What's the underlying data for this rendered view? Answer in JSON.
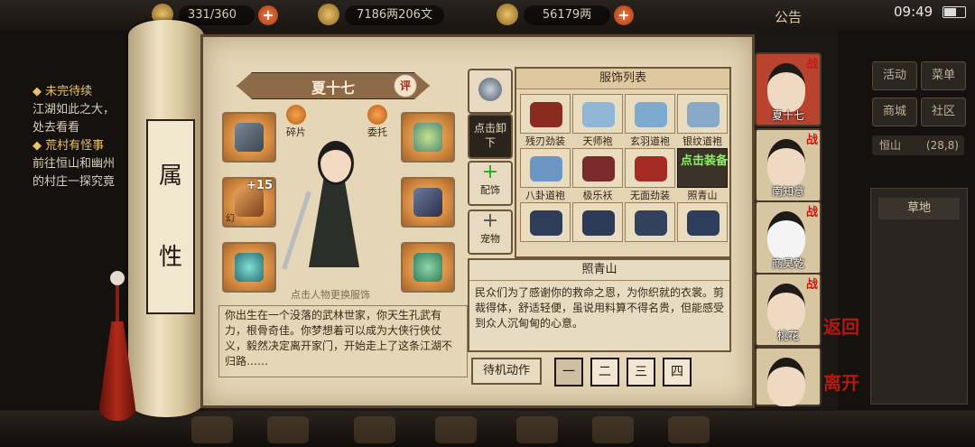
{
  "topbar": {
    "food": "331/360",
    "money": "7186两206文",
    "silver": "56179两",
    "notice": "公告",
    "time": "09:49"
  },
  "quests": [
    {
      "title": "未完待续",
      "text": "江湖如此之大，处去看看"
    },
    {
      "title": "荒村有怪事",
      "text": "前往恒山和幽州的村庄一探究竟"
    }
  ],
  "scroll": {
    "label_top": "属",
    "label_bottom": "性"
  },
  "character": {
    "name": "夏十七",
    "rate_label": "评",
    "fragment_label": "碎片",
    "entrust_label": "委托",
    "tap_hint": "点击人物更换服饰",
    "bio": "你出生在一个没落的武林世家，你天生孔武有力，根骨奇佳。你梦想着可以成为大侠行侠仗义，毅然决定离开家门，开始走上了这条江湖不归路……"
  },
  "slots": {
    "level": "+15",
    "tag": "幻"
  },
  "side_buttons": {
    "unequip": "点击卸下",
    "accessory": "配饰",
    "pet": "宠物"
  },
  "outfit": {
    "title": "服饰列表",
    "items": [
      {
        "label": "残刃劲装",
        "color": "#8a2b22"
      },
      {
        "label": "天师袍",
        "color": "#8fb6d6"
      },
      {
        "label": "玄羽道袍",
        "color": "#7faad0"
      },
      {
        "label": "银纹道袍",
        "color": "#89a9c9"
      },
      {
        "label": "八卦道袍",
        "color": "#6c96c6"
      },
      {
        "label": "极乐袄",
        "color": "#7a2a2a"
      },
      {
        "label": "无面劲装",
        "color": "#a52b25"
      },
      {
        "label": "照青山",
        "equip": "点击装备"
      },
      {
        "label": "",
        "color": "#2f3c5a"
      },
      {
        "label": "",
        "color": "#2d3a58"
      },
      {
        "label": "",
        "color": "#33405e"
      },
      {
        "label": "",
        "color": "#2f3d5d"
      }
    ],
    "selected_name": "照青山",
    "selected_desc": "民众们为了感谢你的救命之恩，为你织就的衣裳。剪裁得体，舒适轻便，虽说用料算不得名贵，但能感受到众人沉甸甸的心意。"
  },
  "idle": {
    "label": "待机动作",
    "options": [
      "一",
      "二",
      "三",
      "四"
    ]
  },
  "party": [
    {
      "name": "夏十七",
      "tag": "战"
    },
    {
      "name": "南知意",
      "tag": "战"
    },
    {
      "name": "商昊乾",
      "tag": "战"
    },
    {
      "name": "桃花",
      "tag": "战"
    },
    {
      "name": ""
    }
  ],
  "nav": {
    "back": "返回",
    "leave": "离开"
  },
  "right_menu": {
    "activity": "活动",
    "menu": "菜单",
    "shop": "商城",
    "community": "社区",
    "location": "恒山",
    "coords": "(28,8)",
    "area": "草地"
  }
}
